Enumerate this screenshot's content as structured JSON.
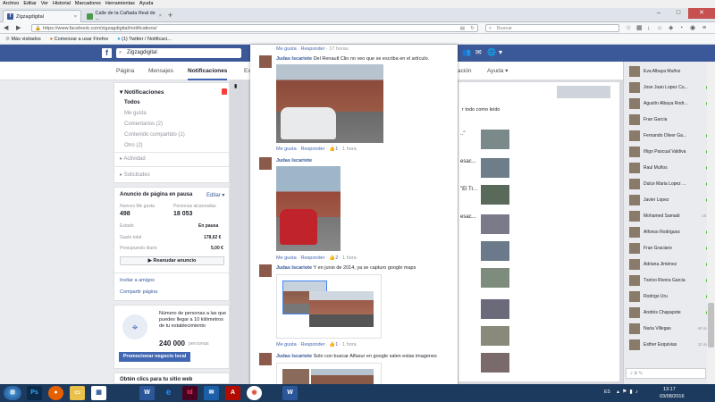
{
  "browser": {
    "menu": [
      "Archivo",
      "Editar",
      "Ver",
      "Historial",
      "Marcadores",
      "Herramientas",
      "Ayuda"
    ],
    "tabs": [
      {
        "label": "Zigzagdigital",
        "active": true
      },
      {
        "label": "Calle de la Cañada Real de ...",
        "active": false
      }
    ],
    "new_tab": "+",
    "url": "https://www.facebook.com/zigzagdigital/notifications/",
    "search_placeholder": "Buscar",
    "bookmarks": [
      "Más visitados",
      "Comenzar a usar Firefox",
      "(1) Twitter / Notificaci..."
    ]
  },
  "fb": {
    "search_value": "Zigzagdigital",
    "page_tabs": [
      "Página",
      "Mensajes",
      "Notificaciones",
      "Es",
      "ación",
      "Ayuda"
    ],
    "active_tab": "Notificaciones"
  },
  "left": {
    "notif_title": "Notificaciones",
    "notif_badge": "",
    "notif_items": [
      "Todos",
      "Me gusta",
      "Comentarios (2)",
      "Contenido compartido (1)",
      "Otro (2)"
    ],
    "activity": "Actividad",
    "requests": "Solicitudes",
    "ad_title": "Anuncio de página en pausa",
    "ad_edit": "Editar",
    "ad_likes_label": "Nuevos Me gusta",
    "ad_likes_value": "498",
    "ad_reach_label": "Personas alcanzadas",
    "ad_reach_value": "18 053",
    "ad_state_label": "Estado",
    "ad_state_value": "En pausa",
    "ad_spent_label": "Gasto total",
    "ad_spent_value": "178,62 €",
    "ad_budget_label": "Presupuesto diario",
    "ad_budget_value": "5,00 €",
    "ad_resume": "Reanudar anuncio",
    "invite": "Invitar a amigos",
    "share": "Compartir página",
    "promo_text": "Número de personas a las que puedes llegar a 10 kilómetros de tu establecimiento",
    "promo_value": "240 000",
    "promo_unit": "personas",
    "promo_button": "Promocionar negocio local",
    "bottom_title": "Obtén clics para tu sitio web"
  },
  "middle": {
    "mark_read": "r todo como leído",
    "snippets": [
      "..\"",
      "esac...",
      "\"El Tr...",
      "esac..."
    ]
  },
  "modal": {
    "top_meta": {
      "like": "Me gusta",
      "reply": "Responder",
      "time": "17 horas"
    },
    "comments": [
      {
        "name": "Judas Iscariote",
        "text": "Del Renault Clio no veo que se escriba en el artículo.",
        "like": "Me gusta",
        "reply": "Responder",
        "count": "1",
        "time": "1 hora"
      },
      {
        "name": "Judas Iscariote",
        "text": "",
        "like": "Me gusta",
        "reply": "Responder",
        "count": "2",
        "time": "1 hora"
      },
      {
        "name": "Judas Iscariote",
        "text": "Y en junio de 2014, ya se capturo google maps",
        "like": "Me gusta",
        "reply": "Responder",
        "count": "1",
        "time": "1 hora"
      },
      {
        "name": "Judas Iscariote",
        "text": "Solo con buscar Alfasur en google salen estas imagenes",
        "like": "",
        "reply": "",
        "count": "",
        "time": ""
      }
    ]
  },
  "chat": [
    {
      "name": "Eva Albaya Muñoz",
      "status": ""
    },
    {
      "name": "Jose Juan Lopez Cu...",
      "status": "dot"
    },
    {
      "name": "Agustín Albaya Rodr...",
      "status": "dot"
    },
    {
      "name": "Fran Garcia",
      "status": ""
    },
    {
      "name": "Fernando Oliver Ga...",
      "status": "dot"
    },
    {
      "name": "Iñigo Pascual Valdiva",
      "status": "dot"
    },
    {
      "name": "Raul Muños",
      "status": "dot"
    },
    {
      "name": "Dulce Maria Lopez ...",
      "status": "dot"
    },
    {
      "name": "Javier Lopez",
      "status": "dot"
    },
    {
      "name": "Mohamed Samadi",
      "status": "16 h"
    },
    {
      "name": "Alfonso Rodriguez",
      "status": "dot"
    },
    {
      "name": "Fran Graciano",
      "status": "dot"
    },
    {
      "name": "Adriana Jiménez",
      "status": "dot"
    },
    {
      "name": "Txelvo Rivera Garcia",
      "status": "dot"
    },
    {
      "name": "Rodrigo Uru",
      "status": "dot"
    },
    {
      "name": "Andrés Chapapote",
      "status": "dot"
    },
    {
      "name": "Nuria Villegas",
      "status": "40 min"
    },
    {
      "name": "Esther Esquivias",
      "status": "11 min"
    }
  ],
  "taskbar": {
    "apps": [
      "start",
      "Ps",
      "firefox",
      "explorer",
      "word",
      "ie",
      "indesign",
      "outlook",
      "acrobat",
      "chrome",
      "word2"
    ],
    "lang": "ES",
    "time": "13:17",
    "date": "03/08/2016"
  },
  "colors": {
    "fb_blue": "#3b5998",
    "link": "#365899",
    "online": "#42b72a",
    "taskbar": "#1c3a5e"
  }
}
